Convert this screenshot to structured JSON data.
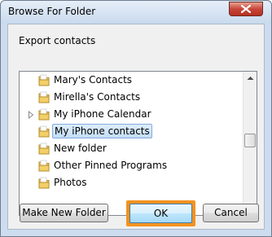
{
  "window": {
    "title": "Browse For Folder",
    "close_icon": "close-icon"
  },
  "description": "Export contacts",
  "tree": {
    "items": [
      {
        "label": "Mary's Contacts",
        "expandable": false,
        "selected": false,
        "icon": "folder-icon"
      },
      {
        "label": "Mirella's Contacts",
        "expandable": false,
        "selected": false,
        "icon": "folder-icon"
      },
      {
        "label": "My iPhone Calendar",
        "expandable": true,
        "selected": false,
        "icon": "folder-icon"
      },
      {
        "label": "My iPhone contacts",
        "expandable": false,
        "selected": true,
        "icon": "folder-icon"
      },
      {
        "label": "New folder",
        "expandable": false,
        "selected": false,
        "icon": "folder-icon"
      },
      {
        "label": "Other Pinned Programs",
        "expandable": false,
        "selected": false,
        "icon": "folder-icon"
      },
      {
        "label": "Photos",
        "expandable": false,
        "selected": false,
        "icon": "folder-icon"
      }
    ]
  },
  "buttons": {
    "new_folder": "Make New Folder",
    "ok": "OK",
    "cancel": "Cancel"
  },
  "colors": {
    "highlight": "#f39221",
    "selection": "#c3ddf6",
    "folder": "#e8c15a"
  }
}
